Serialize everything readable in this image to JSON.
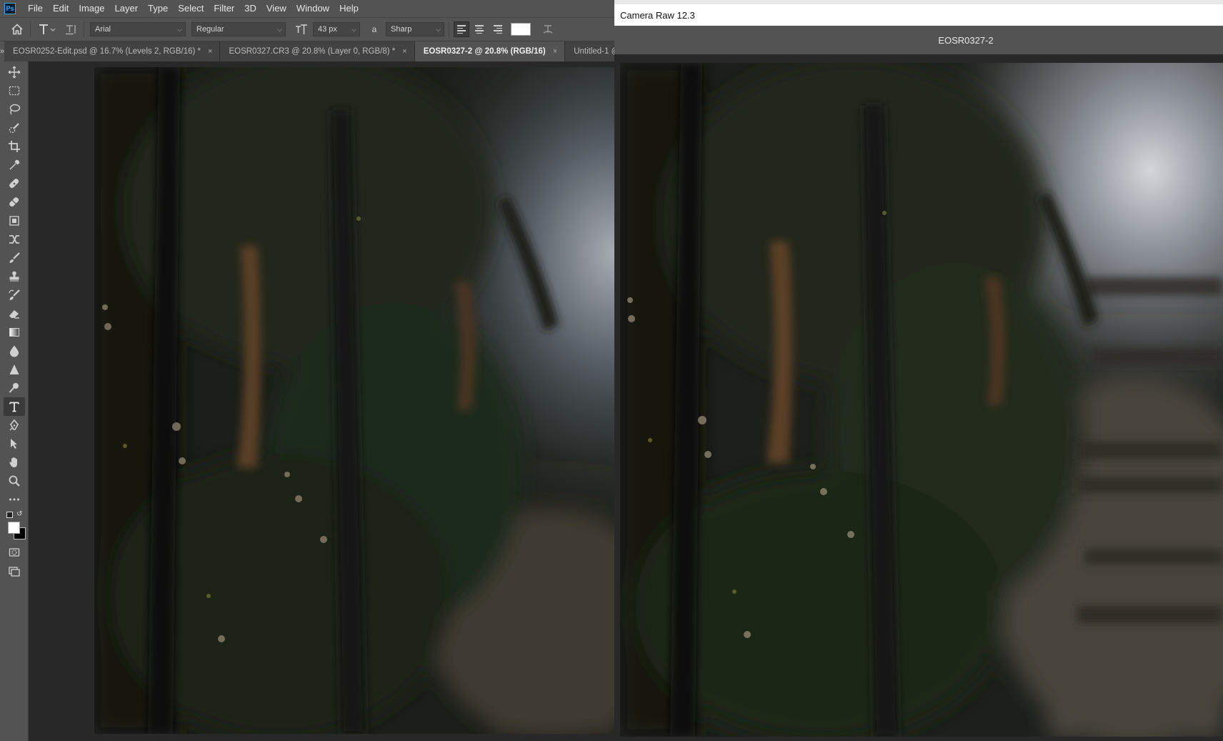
{
  "app": {
    "logo": "Ps"
  },
  "menu": [
    "File",
    "Edit",
    "Image",
    "Layer",
    "Type",
    "Select",
    "Filter",
    "3D",
    "View",
    "Window",
    "Help"
  ],
  "options": {
    "font_family": "Arial",
    "font_style": "Regular",
    "font_size": "43 px",
    "aa_label": "a",
    "antialias": "Sharp",
    "text_color": "#ffffff"
  },
  "tabs": [
    {
      "label": "EOSR0252-Edit.psd @ 16.7% (Levels 2, RGB/16) *",
      "close": "×",
      "active": false
    },
    {
      "label": "EOSR0327.CR3 @ 20.8% (Layer 0, RGB/8) *",
      "close": "×",
      "active": false
    },
    {
      "label": "EOSR0327-2 @ 20.8% (RGB/16)",
      "close": "×",
      "active": true
    },
    {
      "label": "Untitled-1 @",
      "close": "",
      "active": false
    }
  ],
  "tools": [
    "move-tool-icon",
    "marquee-tool-icon",
    "lasso-tool-icon",
    "quick-selection-icon",
    "crop-tool-icon",
    "eyedropper-icon",
    "healing-brush-icon",
    "patch-tool-icon",
    "content-aware-move-icon",
    "transform-icon",
    "brush-tool-icon",
    "clone-stamp-icon",
    "history-brush-icon",
    "eraser-icon",
    "gradient-icon",
    "blur-icon",
    "sharpen-icon",
    "dodge-icon",
    "type-tool-icon",
    "pen-tool-icon",
    "path-selection-icon",
    "hand-tool-icon",
    "zoom-tool-icon",
    "more-tools-icon"
  ],
  "colors": {
    "foreground": "#ffffff",
    "background": "#000000",
    "accent": "#31a8ff"
  },
  "camera_raw": {
    "title": "Camera Raw 12.3",
    "filename": "EOSR0327-2"
  }
}
